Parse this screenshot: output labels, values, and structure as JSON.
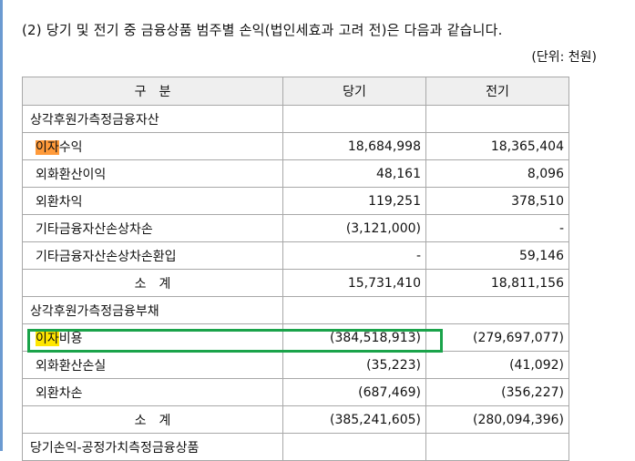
{
  "heading": "(2) 당기 및 전기 중 금융상품 범주별 손익(법인세효과 고려 전)은 다음과 같습니다.",
  "unit": "(단위: 천원)",
  "table": {
    "headers": [
      "구　분",
      "당기",
      "전기"
    ],
    "sections": [
      {
        "title": "상각후원가측정금융자산",
        "rows": [
          {
            "hl": "이자",
            "label": "수익",
            "cur": "18,684,998",
            "prev": "18,365,404"
          },
          {
            "label": "외화환산이익",
            "cur": "48,161",
            "prev": "8,096"
          },
          {
            "label": "외환차익",
            "cur": "119,251",
            "prev": "378,510"
          },
          {
            "label": "기타금융자산손상차손",
            "cur": "(3,121,000)",
            "prev": "-"
          },
          {
            "label": "기타금융자산손상차손환입",
            "cur": "-",
            "prev": "59,146"
          }
        ],
        "subtotal": {
          "label": "소　계",
          "cur": "15,731,410",
          "prev": "18,811,156"
        }
      },
      {
        "title": "상각후원가측정금융부채",
        "rows": [
          {
            "hl": "이자",
            "label": "비용",
            "cur": "(384,518,913)",
            "prev": "(279,697,077)"
          },
          {
            "label": "외화환산손실",
            "cur": "(35,223)",
            "prev": "(41,092)"
          },
          {
            "label": "외환차손",
            "cur": "(687,469)",
            "prev": "(356,227)"
          }
        ],
        "subtotal": {
          "label": "소　계",
          "cur": "(385,241,605)",
          "prev": "(280,094,396)"
        }
      }
    ],
    "next_section_partial": "당기손익-공정가치측정금융상품"
  },
  "colors": {
    "highlight_orange": "#ff9a3a",
    "highlight_yellow": "#ffe600",
    "selection_box": "#1aa34a"
  }
}
